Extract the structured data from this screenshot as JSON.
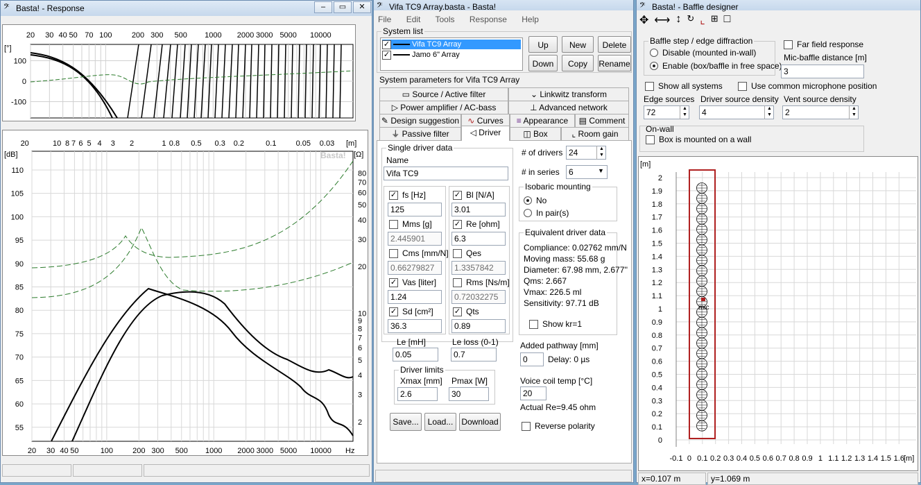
{
  "response_window": {
    "title": "Basta! - Response",
    "phase_plot": {
      "freq_ticks": [
        "20",
        "30",
        "40",
        "50",
        "70",
        "100",
        "200",
        "300",
        "500",
        "1000",
        "2000",
        "3000",
        "5000",
        "10000"
      ],
      "unit": "[°]",
      "y_ticks": [
        "100",
        "0",
        "-100"
      ]
    },
    "main_plot": {
      "dist_ticks": [
        "20",
        "10",
        "8",
        "7",
        "6",
        "5",
        "4",
        "3",
        "2",
        "1",
        "0.8",
        "0.5",
        "0.3",
        "0.2",
        "0.1",
        "0.05",
        "0.03"
      ],
      "dist_unit": "[m]",
      "db_unit": "[dB]",
      "ohm_unit": "[Ω]",
      "db_ticks": [
        "110",
        "105",
        "100",
        "95",
        "90",
        "85",
        "80",
        "75",
        "70",
        "65",
        "60",
        "55"
      ],
      "ohm_ticks": [
        "80",
        "70",
        "60",
        "50",
        "40",
        "30",
        "20",
        "10",
        "9",
        "8",
        "7",
        "6",
        "5",
        "4",
        "3",
        "2"
      ],
      "watermark": "Basta!",
      "freq_ticks": [
        "20",
        "30",
        "40",
        "50",
        "100",
        "200",
        "300",
        "500",
        "1000",
        "2000",
        "3000",
        "5000",
        "10000"
      ],
      "freq_unit": "Hz"
    }
  },
  "main_window": {
    "title": "Vifa TC9 Array.basta - Basta!",
    "menu": [
      "File",
      "Edit",
      "Tools",
      "Response",
      "Help"
    ],
    "system_list": {
      "label": "System list",
      "items": [
        {
          "name": "Vifa TC9 Array",
          "selected": true,
          "color": "#000000"
        },
        {
          "name": "Jamo 6\" Array",
          "selected": false,
          "color": "#000000"
        }
      ],
      "buttons": {
        "up": "Up",
        "new": "New",
        "delete": "Delete",
        "down": "Down",
        "copy": "Copy",
        "rename": "Rename"
      }
    },
    "params_label": "System parameters for Vifa TC9 Array",
    "tabs": {
      "source": "Source / Active filter",
      "linkwitz": "Linkwitz transform",
      "power": "Power amplifier / AC-bass",
      "advanced": "Advanced network",
      "design": "Design suggestion",
      "curves": "Curves",
      "appearance": "Appearance",
      "comment": "Comment",
      "passive": "Passive filter",
      "driver": "Driver",
      "box": "Box",
      "room": "Room gain"
    },
    "driver": {
      "single_label": "Single driver data",
      "name_label": "Name",
      "name_value": "Vifa TC9",
      "fs": {
        "label": "fs [Hz]",
        "value": "125",
        "checked": true
      },
      "bl": {
        "label": "Bl [N/A]",
        "value": "3.01",
        "checked": true
      },
      "mms": {
        "label": "Mms [g]",
        "value": "2.445901",
        "checked": false
      },
      "re": {
        "label": "Re [ohm]",
        "value": "6.3",
        "checked": true
      },
      "cms": {
        "label": "Cms [mm/N]",
        "value": "0.66279827",
        "checked": false
      },
      "qes": {
        "label": "Qes",
        "value": "1.3357842",
        "checked": false
      },
      "vas": {
        "label": "Vas [liter]",
        "value": "1.24",
        "checked": true
      },
      "rms": {
        "label": "Rms [Ns/m]",
        "value": "0.72032275",
        "checked": false
      },
      "sd": {
        "label": "Sd [cm²]",
        "value": "36.3",
        "checked": true
      },
      "qts": {
        "label": "Qts",
        "value": "0.89",
        "checked": true
      },
      "le": {
        "label": "Le [mH]",
        "value": "0.05"
      },
      "leloss": {
        "label": "Le loss (0-1)",
        "value": "0.7"
      },
      "limits_label": "Driver limits",
      "xmax": {
        "label": "Xmax [mm]",
        "value": "2.6"
      },
      "pmax": {
        "label": "Pmax [W]",
        "value": "30"
      },
      "save": "Save...",
      "load": "Load...",
      "download": "Download",
      "num_drivers": {
        "label": "# of drivers",
        "value": "24"
      },
      "in_series": {
        "label": "# in series",
        "value": "6"
      },
      "isobaric": {
        "label": "Isobaric mounting",
        "no": "No",
        "pairs": "In pair(s)"
      },
      "equiv": {
        "label": "Equivalent driver data",
        "compliance": "Compliance: 0.02762 mm/N",
        "mass": "Moving mass: 55.68 g",
        "diameter": "Diameter: 67.98 mm, 2.677''",
        "qms": "Qms: 2.667",
        "vmax": "Vmax: 226.5 ml",
        "sens": "Sensitivity: 97.71 dB",
        "showkr": "Show kr=1"
      },
      "pathway": {
        "label": "Added pathway [mm]",
        "value": "0",
        "delay": "Delay: 0 µs"
      },
      "vctemp": {
        "label": "Voice coil temp [°C]",
        "value": "20",
        "actual": "Actual Re=9.45 ohm"
      },
      "reverse": "Reverse polarity"
    }
  },
  "baffle_window": {
    "title": "Basta! - Baffle designer",
    "step_label": "Baffle step / edge diffraction",
    "disable": "Disable (mounted in-wall)",
    "enable": "Enable (box/baffle in free space)",
    "far_field": "Far field response",
    "mic_dist": {
      "label": "Mic-baffle distance [m]",
      "value": "3"
    },
    "show_all": "Show all systems",
    "common_mic": "Use common microphone position",
    "edge": {
      "label": "Edge sources",
      "value": "72"
    },
    "driver_density": {
      "label": "Driver source density",
      "value": "4"
    },
    "vent_density": {
      "label": "Vent source density",
      "value": "2"
    },
    "onwall": "On-wall",
    "onwall_box": "Box is mounted on a wall",
    "unit": "[m]",
    "y_ticks": [
      "2",
      "1.9",
      "1.8",
      "1.7",
      "1.6",
      "1.5",
      "1.4",
      "1.3",
      "1.2",
      "1.1",
      "1",
      "0.9",
      "0.8",
      "0.7",
      "0.6",
      "0.5",
      "0.4",
      "0.3",
      "0.2",
      "0.1",
      "0"
    ],
    "x_ticks": [
      "-0.1",
      "0",
      "0.1",
      "0.2",
      "0.3",
      "0.4",
      "0.5",
      "0.6",
      "0.7",
      "0.8",
      "0.9",
      "1",
      "1.1",
      "1.2",
      "1.3",
      "1.4",
      "1.5",
      "1.6"
    ],
    "x_unit": "[m]",
    "mic_label": "mic",
    "status_x": "x=0.107 m",
    "status_y": "y=1.069 m"
  }
}
